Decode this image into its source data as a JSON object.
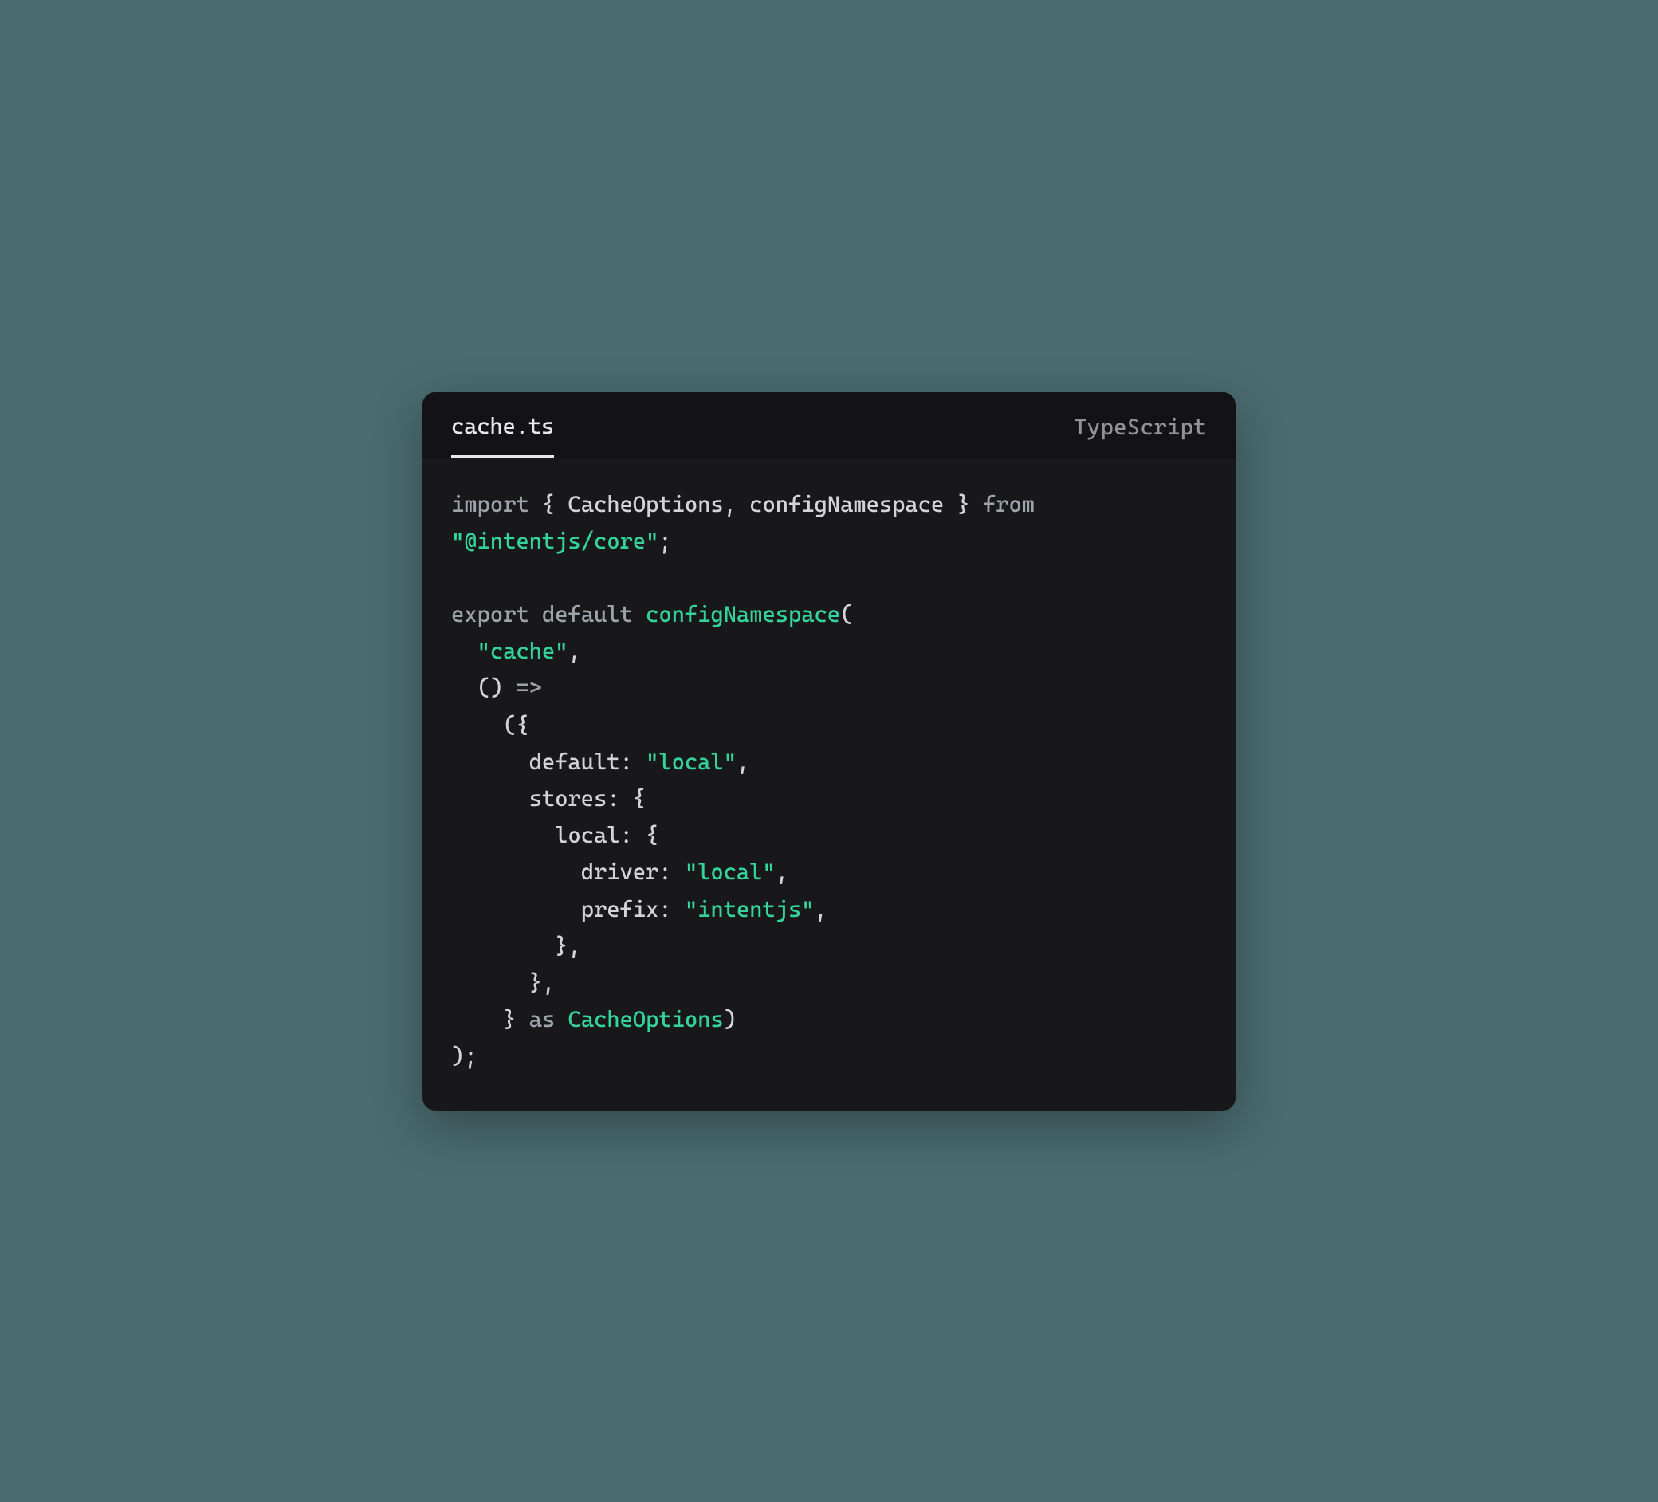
{
  "header": {
    "filename": "cache.ts",
    "language": "TypeScript"
  },
  "code": {
    "line1": {
      "kw_import": "import",
      "brace_open": " { ",
      "id_cacheoptions": "CacheOptions",
      "comma": ", ",
      "id_confignamespace": "configNamespace",
      "brace_close": " } ",
      "kw_from": "from"
    },
    "line2": {
      "str_module": "\"@intentjs/core\"",
      "semicolon": ";"
    },
    "line4": {
      "kw_export": "export",
      "sp1": " ",
      "kw_default": "default",
      "sp2": " ",
      "func_name": "configNamespace",
      "paren_open": "("
    },
    "line5": {
      "indent": "  ",
      "str_cache": "\"cache\"",
      "comma": ","
    },
    "line6": {
      "indent": "  ",
      "parens": "()",
      "sp": " ",
      "arrow": "=>"
    },
    "line7": {
      "indent": "    ",
      "open": "({"
    },
    "line8": {
      "indent": "      ",
      "prop": "default",
      "colon": ": ",
      "str_val": "\"local\"",
      "comma": ","
    },
    "line9": {
      "indent": "      ",
      "prop": "stores",
      "colon": ": ",
      "brace": "{"
    },
    "line10": {
      "indent": "        ",
      "prop": "local",
      "colon": ": ",
      "brace": "{"
    },
    "line11": {
      "indent": "          ",
      "prop": "driver",
      "colon": ": ",
      "str_val": "\"local\"",
      "comma": ","
    },
    "line12": {
      "indent": "          ",
      "prop": "prefix",
      "colon": ": ",
      "str_val": "\"intentjs\"",
      "comma": ","
    },
    "line13": {
      "indent": "        ",
      "close": "},"
    },
    "line14": {
      "indent": "      ",
      "close": "},"
    },
    "line15": {
      "indent": "    ",
      "close_brace": "}",
      "sp1": " ",
      "kw_as": "as",
      "sp2": " ",
      "type": "CacheOptions",
      "close_paren": ")"
    },
    "line16": {
      "close": ");"
    }
  }
}
